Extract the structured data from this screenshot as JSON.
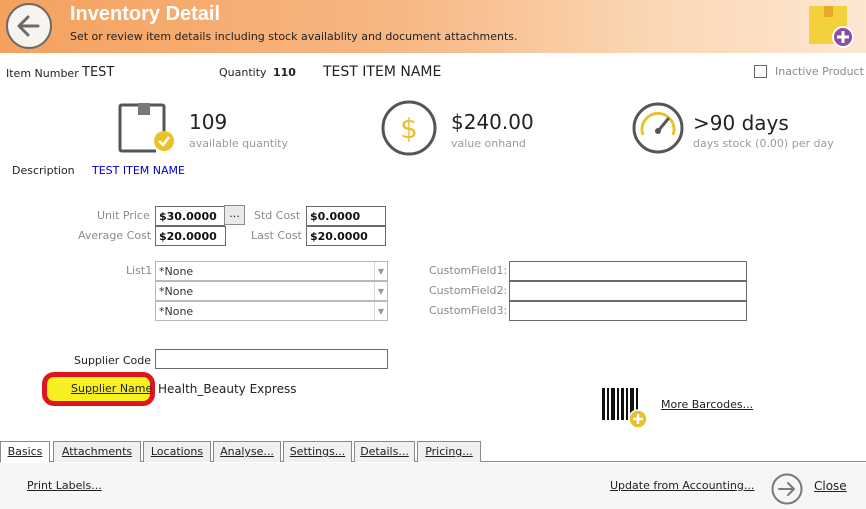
{
  "header": {
    "title": "Inventory Detail",
    "subtitle": "Set or review item details including stock availablity and document attachments."
  },
  "item": {
    "number_label": "Item Number",
    "number_value": "TEST",
    "quantity_label": "Quantity",
    "quantity_value": "110",
    "name": "TEST ITEM NAME",
    "inactive_label": "Inactive Product",
    "inactive_checked": false
  },
  "stats": {
    "available": {
      "value": "109",
      "caption": "available quantity"
    },
    "value_onhand": {
      "value": "$240.00",
      "caption": "value onhand"
    },
    "days_stock": {
      "value": ">90 days",
      "caption": "days stock (0.00) per day"
    }
  },
  "description": {
    "label": "Description",
    "value": "TEST ITEM NAME"
  },
  "pricing": {
    "unit_price_label": "Unit Price",
    "unit_price": "$30.0000",
    "avg_cost_label": "Average Cost",
    "avg_cost": "$20.0000",
    "std_cost_label": "Std Cost",
    "std_cost": "$0.0000",
    "last_cost_label": "Last Cost",
    "last_cost": "$20.0000",
    "ellipsis": "..."
  },
  "lists": {
    "label": "List1",
    "values": [
      "*None",
      "*None",
      "*None"
    ]
  },
  "custom": {
    "labels": [
      "CustomField1:",
      "CustomField2:",
      "CustomField3:"
    ],
    "values": [
      "",
      "",
      ""
    ]
  },
  "supplier": {
    "code_label": "Supplier Code",
    "code_value": "",
    "name_label": "Supplier Name",
    "name_value": "Health_Beauty Express"
  },
  "barcodes": {
    "label": "More Barcodes..."
  },
  "tabs": [
    {
      "label": "Basics",
      "active": true
    },
    {
      "label": "Attachments",
      "active": false
    },
    {
      "label": "Locations",
      "active": false
    },
    {
      "label": "Analyse...",
      "active": false
    },
    {
      "label": "Settings...",
      "active": false
    },
    {
      "label": "Details...",
      "active": false
    },
    {
      "label": "Pricing...",
      "active": false
    }
  ],
  "footer": {
    "print_labels": "Print Labels...",
    "update_from_accounting": "Update from Accounting...",
    "close": "Close"
  },
  "colors": {
    "accent_orange": "#f4a15e",
    "icon_gold": "#e9c12a",
    "highlight_yellow": "#f7f020",
    "annotation_red": "#e0141c",
    "description_blue": "#0000cc"
  }
}
